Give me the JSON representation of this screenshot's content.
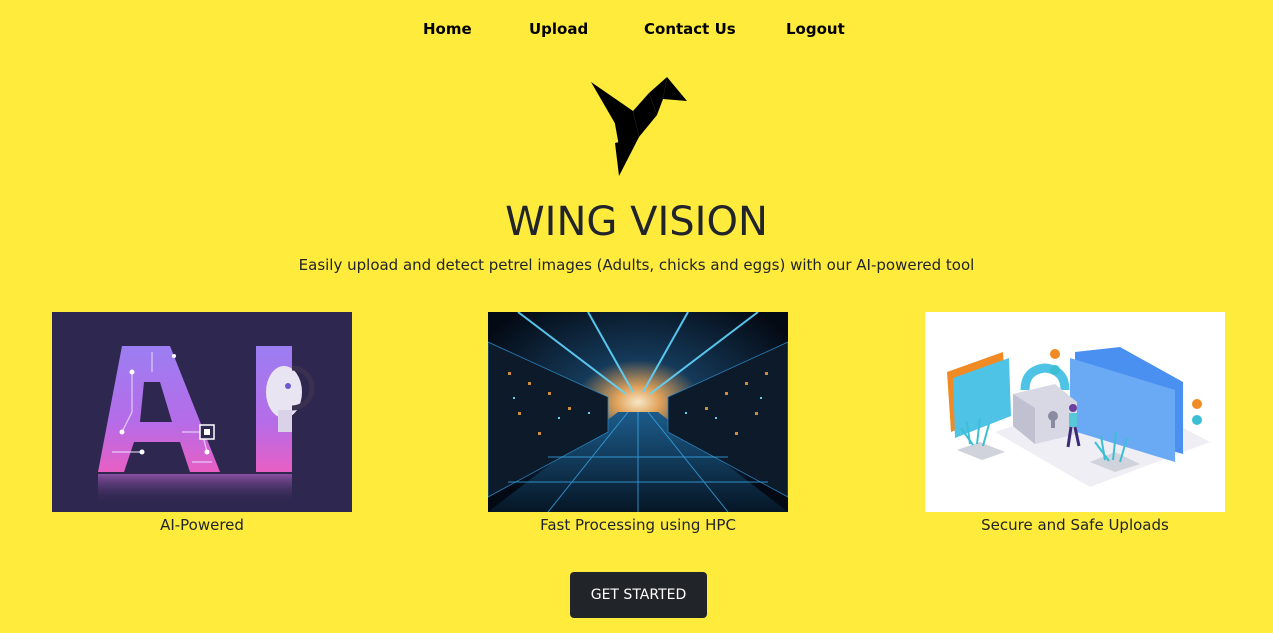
{
  "nav": {
    "items": [
      {
        "label": "Home"
      },
      {
        "label": "Upload"
      },
      {
        "label": "Contact Us"
      },
      {
        "label": "Logout"
      }
    ]
  },
  "hero": {
    "title": "WING VISION",
    "subtitle": "Easily upload and detect petrel images (Adults, chicks and eggs) with our AI-powered tool"
  },
  "features": [
    {
      "caption": "AI-Powered",
      "image_text": "AI"
    },
    {
      "caption": "Fast Processing using HPC"
    },
    {
      "caption": "Secure and Safe Uploads"
    }
  ],
  "cta": {
    "label": "GET STARTED"
  },
  "colors": {
    "background": "#ffeb3b",
    "button": "#212529",
    "text": "#212529"
  }
}
